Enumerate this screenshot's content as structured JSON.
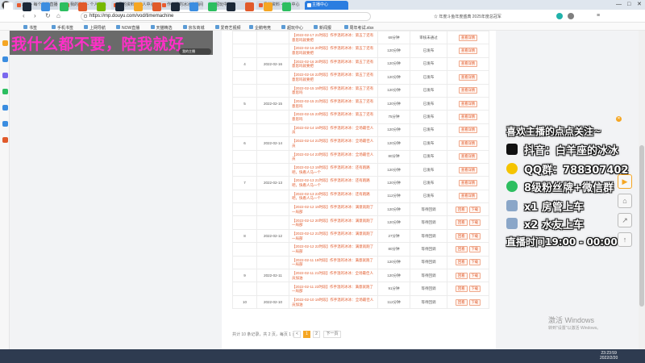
{
  "browser": {
    "tabs": [
      {
        "label": "斗鱼 - 每个人的直播平台",
        "active": false
      },
      {
        "label": "我的资料 - 个人中心 - 斗鱼",
        "active": false
      },
      {
        "label": "我的资料 - 个人中心 - 斗鱼",
        "active": false
      },
      {
        "label": "作者温的冰冰直播间_斗鱼",
        "active": false
      },
      {
        "label": "超玩中心",
        "active": false
      },
      {
        "label": "我的资料 - 个人中心",
        "active": false
      },
      {
        "label": "主播中心",
        "active": true
      }
    ],
    "url": "https://mp.douyu.com/vod/timemachine",
    "nav_right_text": "☆ 年度斗鱼年度盛典 2025年度总冠军",
    "bookmarks": [
      "书签",
      "手机书签",
      "上网导航",
      "NOW直播",
      "天猫精选",
      "京东商城",
      "爱奇艺视频",
      "企鹅电竞",
      "超玩中心",
      "新闻报",
      "周年考试.xlsx"
    ]
  },
  "overlay": {
    "banner_text": "我什么都不要，陪我就好",
    "banner_tag": "我的主播",
    "lines": [
      "喜欢主播的点点关注~",
      "抖音：白羊座的冰冰",
      "QQ群：788307402",
      "8级粉丝牌+微信群",
      "x1 房管上车",
      "x2 水友上车",
      "直播时间19:00 - 00:00"
    ]
  },
  "table": {
    "rows": [
      {
        "index": "",
        "date": "",
        "title": "【2022-02-17 21时段】作手温的冰冰：第五了还有意思吗就要把",
        "duration": "69分钟",
        "status": "审核未通过",
        "actions": [
          "查看详情"
        ]
      },
      {
        "index": "",
        "date": "",
        "title": "【2022-02-16 20时段】作手温的冰冰：第五了还有意思吗就要把",
        "duration": "120分钟",
        "status": "已发布",
        "actions": [
          "查看详情"
        ]
      },
      {
        "index": "4",
        "date": "2022-02-16",
        "title": "【2022-02-16 20时段】作手温的冰冰：第五了还有意思吗就要把",
        "duration": "120分钟",
        "status": "已发布",
        "actions": [
          "查看详情"
        ]
      },
      {
        "index": "",
        "date": "",
        "title": "【2022-02-16 22时段】作手温的冰冰：第五了还有意思吗就要把",
        "duration": "120分钟",
        "status": "已发布",
        "actions": [
          "查看详情"
        ]
      },
      {
        "index": "",
        "date": "",
        "title": "【2022-02-15 19时段】作手温的冰冰：第五了还有意思吗",
        "duration": "120分钟",
        "status": "已发布",
        "actions": [
          "查看详情"
        ]
      },
      {
        "index": "5",
        "date": "2022-02-15",
        "title": "【2022-02-15 21时段】作手温的冰冰：第五了还有意思吗",
        "duration": "120分钟",
        "status": "已发布",
        "actions": [
          "查看详情"
        ]
      },
      {
        "index": "",
        "date": "",
        "title": "【2022-02-15 23时段】作手温的冰冰：第五了还有意思吗",
        "duration": "75分钟",
        "status": "已发布",
        "actions": [
          "查看详情"
        ]
      },
      {
        "index": "",
        "date": "",
        "title": "【2022-02-14 19时段】作手温的冰冰：全场最佳人员",
        "duration": "120分钟",
        "status": "已发布",
        "actions": [
          "查看详情"
        ]
      },
      {
        "index": "6",
        "date": "2022-02-14",
        "title": "【2022-02-14 21时段】作手温的冰冰：全场最佳人员",
        "duration": "120分钟",
        "status": "已发布",
        "actions": [
          "查看详情"
        ]
      },
      {
        "index": "",
        "date": "",
        "title": "【2022-02-14 23时段】作手温的冰冰：全场最佳人员",
        "duration": "80分钟",
        "status": "已发布",
        "actions": [
          "查看详情"
        ]
      },
      {
        "index": "",
        "date": "",
        "title": "【2022-02-13 19时段】作手温的冰冰：还有跑路吧，快看人马一个",
        "duration": "120分钟",
        "status": "已发布",
        "actions": [
          "查看详情"
        ]
      },
      {
        "index": "7",
        "date": "2022-02-13",
        "title": "【2022-02-13 21时段】作手温的冰冰：还有跑路吧，快看人马一个",
        "duration": "120分钟",
        "status": "已发布",
        "actions": [
          "查看详情"
        ]
      },
      {
        "index": "",
        "date": "",
        "title": "【2022-02-13 23时段】作手温的冰冰：还有跑路吧，快看人马一个",
        "duration": "112分钟",
        "status": "已发布",
        "actions": [
          "查看详情"
        ]
      },
      {
        "index": "",
        "date": "",
        "title": "【2022-02-12 19时段】作手温的冰冰：满意就跑了一局部",
        "duration": "120分钟",
        "status": "等待回调",
        "actions": [
          "回看",
          "下载"
        ]
      },
      {
        "index": "",
        "date": "",
        "title": "【2022-02-12 20时段】作手温的冰冰：满意就跑了一局部",
        "duration": "120分钟",
        "status": "等待回调",
        "actions": [
          "回看",
          "下载"
        ]
      },
      {
        "index": "8",
        "date": "2022-02-12",
        "title": "【2022-02-12 21时段】作手温的冰冰：满意就跑了一局部",
        "duration": "27分钟",
        "status": "等待回调",
        "actions": [
          "回看",
          "下载"
        ]
      },
      {
        "index": "",
        "date": "",
        "title": "【2022-02-12 22时段】作手温的冰冰：满意就跑了一局部",
        "duration": "80分钟",
        "status": "等待回调",
        "actions": [
          "回看",
          "下载"
        ]
      },
      {
        "index": "",
        "date": "",
        "title": "【2022-02-11 19时段】作手温的冰冰：满意就跑了一局部",
        "duration": "120分钟",
        "status": "等待回调",
        "actions": [
          "回看",
          "下载"
        ]
      },
      {
        "index": "9",
        "date": "2022-02-11",
        "title": "【2022-02-11 21时段】作手温的冰冰：全场最佳人员加油",
        "duration": "120分钟",
        "status": "等待回调",
        "actions": [
          "回看",
          "下载"
        ]
      },
      {
        "index": "",
        "date": "",
        "title": "【2022-02-11 23时段】作手温的冰冰：满意就跑了一局部",
        "duration": "91分钟",
        "status": "等待回调",
        "actions": [
          "回看",
          "下载"
        ]
      },
      {
        "index": "10",
        "date": "2022-02-10",
        "title": "【2022-02-10 19时段】作手温的冰冰：全场最佳人员加油",
        "duration": "112分钟",
        "status": "等待回调",
        "actions": [
          "回看",
          "下载"
        ]
      }
    ]
  },
  "pagination": {
    "summary": "共计 10 条记录，共 2 页，每页 1 页",
    "prev": "<",
    "pages": [
      "1",
      "2"
    ],
    "current": "1",
    "next": "下一页"
  },
  "system": {
    "watermark_title": "激活 Windows",
    "watermark_sub": "转到\"设置\"以激活 Windows。",
    "time": "23:23:59",
    "date": "2022/2/20"
  }
}
